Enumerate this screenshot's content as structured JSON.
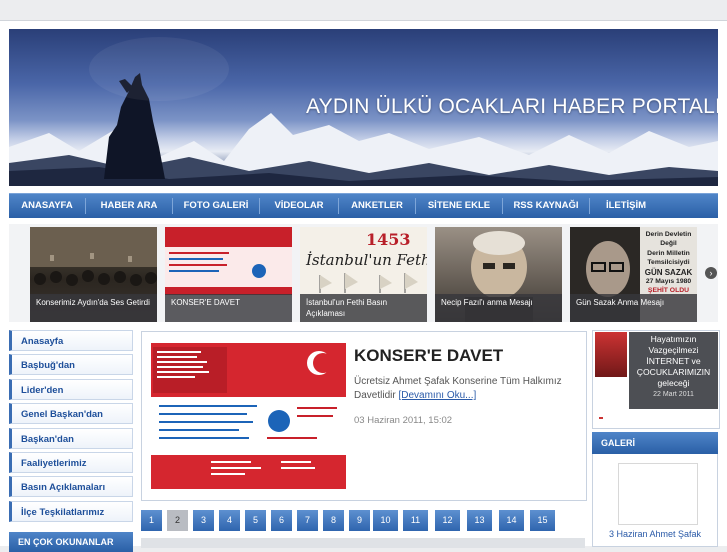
{
  "header": {
    "title": "AYDIN ÜLKÜ OCAKLARI HABER PORTALI"
  },
  "nav": [
    "ANASAYFA",
    "HABER ARA",
    "FOTO GALERİ",
    "VİDEOLAR",
    "ANKETLER",
    "SİTENE EKLE",
    "RSS KAYNAĞI",
    "İLETİŞİM"
  ],
  "carousel": {
    "slides": [
      {
        "caption": "Konserimiz Aydın'da Ses Getirdi"
      },
      {
        "caption": "KONSER'E DAVET"
      },
      {
        "caption": "İstanbul'un Fethi Basın Açıklaması"
      },
      {
        "caption": "Necip Fazıl'ı anma Mesajı"
      },
      {
        "caption": "Gün Sazak Anma Mesajı"
      }
    ],
    "slide3_title": "1453",
    "slide3_sub": "İstanbul'un Fethi",
    "slide5_overlay": [
      "Derin Devletin",
      "Değil",
      "Derin Milletin",
      "Temsilcisiydi",
      "GÜN SAZAK",
      "27 Mayıs 1980",
      "ŞEHİT OLDU"
    ]
  },
  "sidebar": {
    "items": [
      "Anasayfa",
      "Başbuğ'dan",
      "Lider'den",
      "Genel Başkan'dan",
      "Başkan'dan",
      "Faaliyetlerimiz",
      "Basın Açıklamaları",
      "İlçe Teşkilatlarımız"
    ],
    "section_title": "EN ÇOK OKUNANLAR"
  },
  "feature": {
    "title": "KONSER'E DAVET",
    "description": "Ücretsiz Ahmet Şafak Konserine Tüm Halkımız Davetlidir",
    "more_link": "[Devamını Oku...]",
    "date": "03 Haziran 2011, 15:02"
  },
  "pagination": {
    "pages": [
      "1",
      "2",
      "3",
      "4",
      "5",
      "6",
      "7",
      "8",
      "9",
      "10",
      "11",
      "12",
      "13",
      "14",
      "15"
    ],
    "active": "2"
  },
  "ad": {
    "lines": [
      "Hayatımızın",
      "Vazgeçilmezi",
      "İNTERNET ve",
      "ÇOCUKLARIMIZIN",
      "geleceği"
    ],
    "date": "22 Mart 2011"
  },
  "gallery": {
    "title": "GALERİ",
    "caption": "3 Haziran Ahmet Şafak"
  },
  "colors": {
    "nav_blue": "#2a5fa6",
    "link_blue": "#1e4f9a",
    "page_bg": "#ecedef"
  }
}
